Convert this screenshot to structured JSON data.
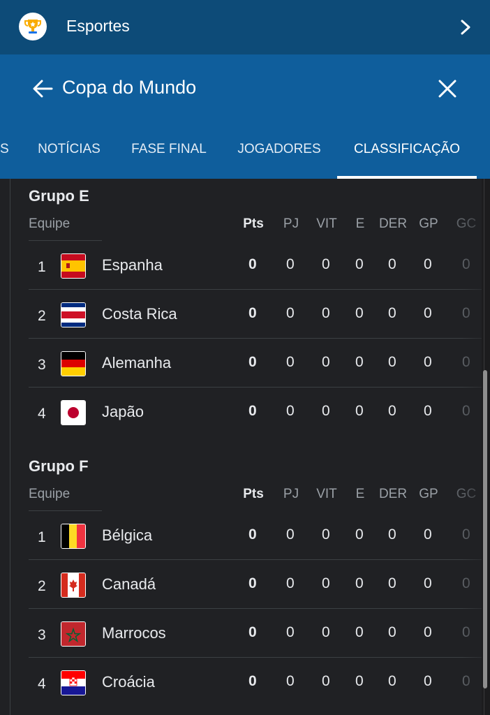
{
  "topbar": {
    "title": "Esportes"
  },
  "header": {
    "title": "Copa do Mundo"
  },
  "tabs": [
    {
      "label": "S"
    },
    {
      "label": "NOTÍCIAS"
    },
    {
      "label": "FASE FINAL"
    },
    {
      "label": "JOGADORES"
    },
    {
      "label": "CLASSIFICAÇÃO",
      "active": true
    }
  ],
  "columns": {
    "team": "Equipe",
    "pts": "Pts",
    "pj": "PJ",
    "vit": "VIT",
    "e": "E",
    "der": "DER",
    "gp": "GP",
    "gc": "GC"
  },
  "groups": [
    {
      "title": "Grupo E",
      "teams": [
        {
          "rank": "1",
          "name": "Espanha",
          "flag": "spain-flag-icon",
          "qualified": true,
          "pts": "0",
          "pj": "0",
          "vit": "0",
          "e": "0",
          "der": "0",
          "gp": "0",
          "gc": "0"
        },
        {
          "rank": "2",
          "name": "Costa Rica",
          "flag": "costa-rica-flag-icon",
          "qualified": true,
          "pts": "0",
          "pj": "0",
          "vit": "0",
          "e": "0",
          "der": "0",
          "gp": "0",
          "gc": "0"
        },
        {
          "rank": "3",
          "name": "Alemanha",
          "flag": "germany-flag-icon",
          "qualified": false,
          "pts": "0",
          "pj": "0",
          "vit": "0",
          "e": "0",
          "der": "0",
          "gp": "0",
          "gc": "0"
        },
        {
          "rank": "4",
          "name": "Japão",
          "flag": "japan-flag-icon",
          "qualified": false,
          "pts": "0",
          "pj": "0",
          "vit": "0",
          "e": "0",
          "der": "0",
          "gp": "0",
          "gc": "0"
        }
      ]
    },
    {
      "title": "Grupo F",
      "teams": [
        {
          "rank": "1",
          "name": "Bélgica",
          "flag": "belgium-flag-icon",
          "qualified": true,
          "pts": "0",
          "pj": "0",
          "vit": "0",
          "e": "0",
          "der": "0",
          "gp": "0",
          "gc": "0"
        },
        {
          "rank": "2",
          "name": "Canadá",
          "flag": "canada-flag-icon",
          "qualified": true,
          "pts": "0",
          "pj": "0",
          "vit": "0",
          "e": "0",
          "der": "0",
          "gp": "0",
          "gc": "0"
        },
        {
          "rank": "3",
          "name": "Marrocos",
          "flag": "morocco-flag-icon",
          "qualified": false,
          "pts": "0",
          "pj": "0",
          "vit": "0",
          "e": "0",
          "der": "0",
          "gp": "0",
          "gc": "0"
        },
        {
          "rank": "4",
          "name": "Croácia",
          "flag": "croatia-flag-icon",
          "qualified": false,
          "pts": "0",
          "pj": "0",
          "vit": "0",
          "e": "0",
          "der": "0",
          "gp": "0",
          "gc": "0"
        }
      ]
    }
  ],
  "colors": {
    "topbar": "#0d4b78",
    "header": "#0f5e9c",
    "background": "#202124",
    "accent": "#4a86d9"
  }
}
